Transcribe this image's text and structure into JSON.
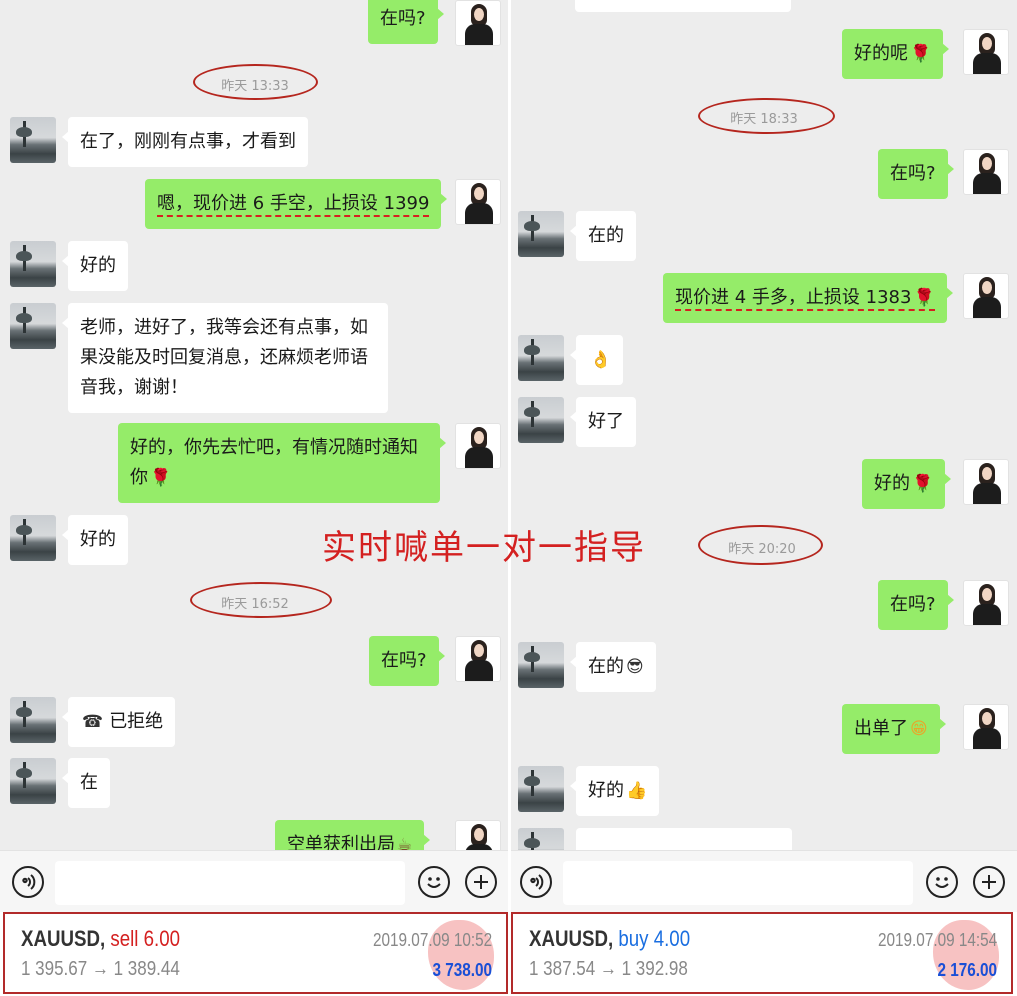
{
  "left": {
    "timestamps": [
      "昨天 13:33",
      "昨天 16:52"
    ],
    "messages": [
      "在吗?",
      "在了，刚刚有点事，才看到",
      "嗯，现价进 6 手空，止损设 1399",
      "好的",
      "老师，进好了，我等会还有点事，如果没能及时回复消息，还麻烦老师语音我，谢谢！",
      "好的，你先去忙吧，有情况随时通知你",
      "好的",
      "在吗?",
      "已拒绝",
      "在",
      "空单获利出局"
    ]
  },
  "right": {
    "timestamps": [
      "昨天 18:33",
      "昨天 20:20"
    ],
    "messages": [
      "好的呢",
      "在吗?",
      "在的",
      "现价进 4 手多，止损设 1383",
      "好了",
      "好的",
      "在吗?",
      "在的",
      "出单了",
      "好的"
    ]
  },
  "emojis": {
    "rose": "🌹",
    "ok_hand": "👌",
    "sunglasses": "😎",
    "grin": "😁",
    "thumbs_up": "👍",
    "coffee": "☕",
    "call_declined": "☎"
  },
  "watermark": "实时喊单一对一指导",
  "trades": {
    "left": {
      "symbol": "XAUUSD,",
      "side": "sell 6.00",
      "prices": "1 395.67 → 1 389.44",
      "datetime": "2019.07.09 10:52",
      "profit": "3 738.00",
      "side_color": "#d42020"
    },
    "right": {
      "symbol": "XAUUSD,",
      "side": "buy 4.00",
      "prices": "1 387.54 → 1 392.98",
      "datetime": "2019.07.09 14:54",
      "profit": "2 176.00",
      "side_color": "#1a6ee0"
    }
  },
  "icons": {
    "voice": "voice-icon",
    "emoji": "emoji-icon",
    "plus": "plus-icon"
  },
  "colors": {
    "chat_bg": "#ededed",
    "outgoing_bubble": "#95ec69",
    "incoming_bubble": "#ffffff",
    "annotation_red": "#d42020",
    "profit_blue": "#1a4fd6"
  }
}
